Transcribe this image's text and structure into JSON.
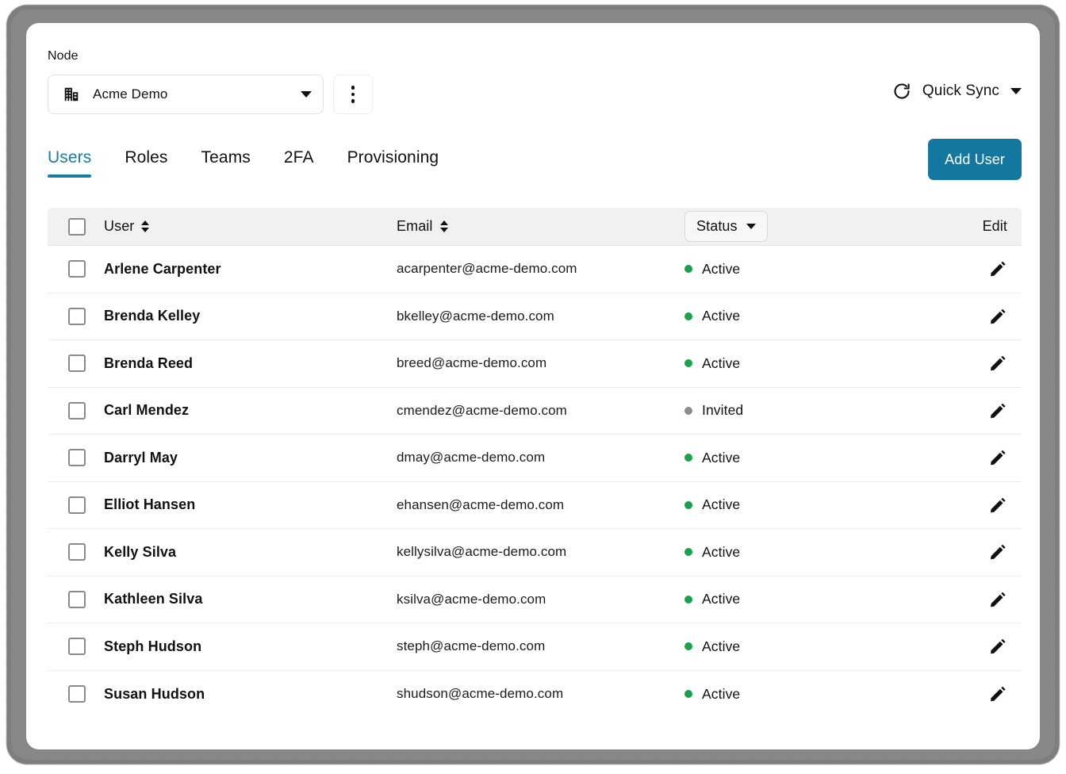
{
  "node": {
    "label": "Node",
    "selected": "Acme Demo",
    "icon": "building-icon",
    "menu_icon": "kebab-menu-icon"
  },
  "quick_sync": {
    "label": "Quick Sync",
    "icon": "refresh-icon"
  },
  "tabs": [
    {
      "label": "Users",
      "active": true
    },
    {
      "label": "Roles",
      "active": false
    },
    {
      "label": "Teams",
      "active": false
    },
    {
      "label": "2FA",
      "active": false
    },
    {
      "label": "Provisioning",
      "active": false
    }
  ],
  "actions": {
    "add_user": "Add User"
  },
  "table": {
    "columns": {
      "select_all": "",
      "user": "User",
      "email": "Email",
      "status": "Status",
      "edit": "Edit"
    },
    "rows": [
      {
        "name": "Arlene Carpenter",
        "email": "acarpenter@acme-demo.com",
        "status": "Active",
        "status_color": "#16a34a"
      },
      {
        "name": "Brenda Kelley",
        "email": "bkelley@acme-demo.com",
        "status": "Active",
        "status_color": "#16a34a"
      },
      {
        "name": "Brenda Reed",
        "email": "breed@acme-demo.com",
        "status": "Active",
        "status_color": "#16a34a"
      },
      {
        "name": "Carl Mendez",
        "email": "cmendez@acme-demo.com",
        "status": "Invited",
        "status_color": "#8c8c8c"
      },
      {
        "name": "Darryl May",
        "email": "dmay@acme-demo.com",
        "status": "Active",
        "status_color": "#16a34a"
      },
      {
        "name": "Elliot Hansen",
        "email": "ehansen@acme-demo.com",
        "status": "Active",
        "status_color": "#16a34a"
      },
      {
        "name": "Kelly Silva",
        "email": "kellysilva@acme-demo.com",
        "status": "Active",
        "status_color": "#16a34a"
      },
      {
        "name": "Kathleen Silva",
        "email": "ksilva@acme-demo.com",
        "status": "Active",
        "status_color": "#16a34a"
      },
      {
        "name": "Steph Hudson",
        "email": "steph@acme-demo.com",
        "status": "Active",
        "status_color": "#16a34a"
      },
      {
        "name": "Susan Hudson",
        "email": "shudson@acme-demo.com",
        "status": "Active",
        "status_color": "#16a34a"
      }
    ]
  },
  "colors": {
    "accent": "#1a7da3",
    "button": "#1477a0",
    "active_status": "#16a34a",
    "invited_status": "#8c8c8c",
    "header_bg": "#f1f1f1"
  }
}
